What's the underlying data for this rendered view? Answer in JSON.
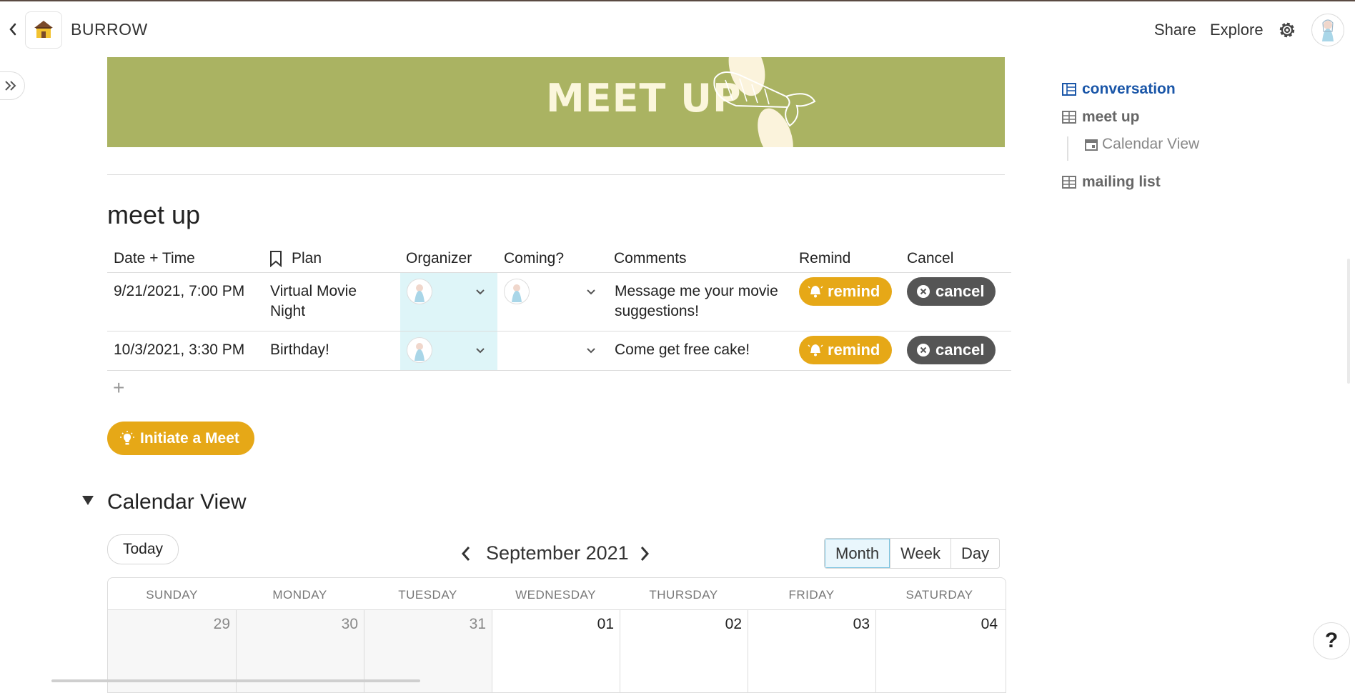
{
  "header": {
    "title": "BURROW",
    "share_label": "Share",
    "explore_label": "Explore"
  },
  "banner": {
    "title": "MEET UP"
  },
  "section": {
    "title": "meet up"
  },
  "table": {
    "columns": {
      "date": "Date + Time",
      "plan": "Plan",
      "organizer": "Organizer",
      "coming": "Coming?",
      "comments": "Comments",
      "remind": "Remind",
      "cancel": "Cancel"
    },
    "rows": [
      {
        "date": "9/21/2021, 7:00 PM",
        "plan": "Virtual Movie Night",
        "comments": "Message me your movie suggestions!",
        "remind": "remind",
        "cancel": "cancel"
      },
      {
        "date": "10/3/2021, 3:30 PM",
        "plan": "Birthday!",
        "comments": "Come get free cake!",
        "remind": "remind",
        "cancel": "cancel"
      }
    ],
    "add_symbol": "+"
  },
  "initiate_button": {
    "label": "Initiate a Meet"
  },
  "calendar": {
    "title": "Calendar View",
    "today_label": "Today",
    "month_label": "September 2021",
    "views": [
      "Month",
      "Week",
      "Day"
    ],
    "active_view": "Month",
    "weekdays": [
      "SUNDAY",
      "MONDAY",
      "TUESDAY",
      "WEDNESDAY",
      "THURSDAY",
      "FRIDAY",
      "SATURDAY"
    ],
    "first_week": [
      "29",
      "30",
      "31",
      "01",
      "02",
      "03",
      "04"
    ]
  },
  "outline": {
    "items": [
      "conversation",
      "meet up",
      "Calendar View",
      "mailing list"
    ],
    "active": "conversation"
  },
  "help_label": "?",
  "colors": {
    "banner": "#aab362",
    "accent_yellow": "#e6a817",
    "cancel_gray": "#555555",
    "organizer_highlight": "#def5f8",
    "outline_active": "#1a56a8"
  }
}
